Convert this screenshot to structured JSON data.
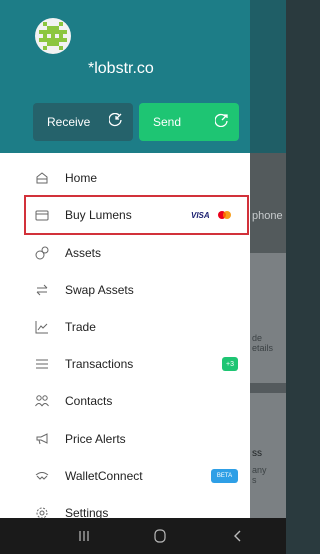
{
  "background": {
    "fragment_phone": "phone",
    "fragment_de": "de",
    "fragment_etails": "etails",
    "fragment_ss": "ss",
    "fragment_any": "any",
    "fragment_s": "s"
  },
  "header": {
    "domain": "*lobstr.co",
    "receive_label": "Receive",
    "send_label": "Send"
  },
  "menu": {
    "items": [
      {
        "label": "Home",
        "icon": "home-icon"
      },
      {
        "label": "Buy Lumens",
        "icon": "card-icon",
        "payment": "VISA"
      },
      {
        "label": "Assets",
        "icon": "assets-icon"
      },
      {
        "label": "Swap Assets",
        "icon": "swap-icon"
      },
      {
        "label": "Trade",
        "icon": "trade-icon"
      },
      {
        "label": "Transactions",
        "icon": "list-icon",
        "badge": "+3"
      },
      {
        "label": "Contacts",
        "icon": "contacts-icon"
      },
      {
        "label": "Price Alerts",
        "icon": "megaphone-icon"
      },
      {
        "label": "WalletConnect",
        "icon": "walletconnect-icon",
        "badge": "BETA"
      },
      {
        "label": "Settings",
        "icon": "gear-icon"
      }
    ]
  },
  "colors": {
    "header": "#1d7d87",
    "receive": "#25626b",
    "send": "#1ec573",
    "highlight": "#d2313a",
    "beta": "#2e9fe6"
  }
}
